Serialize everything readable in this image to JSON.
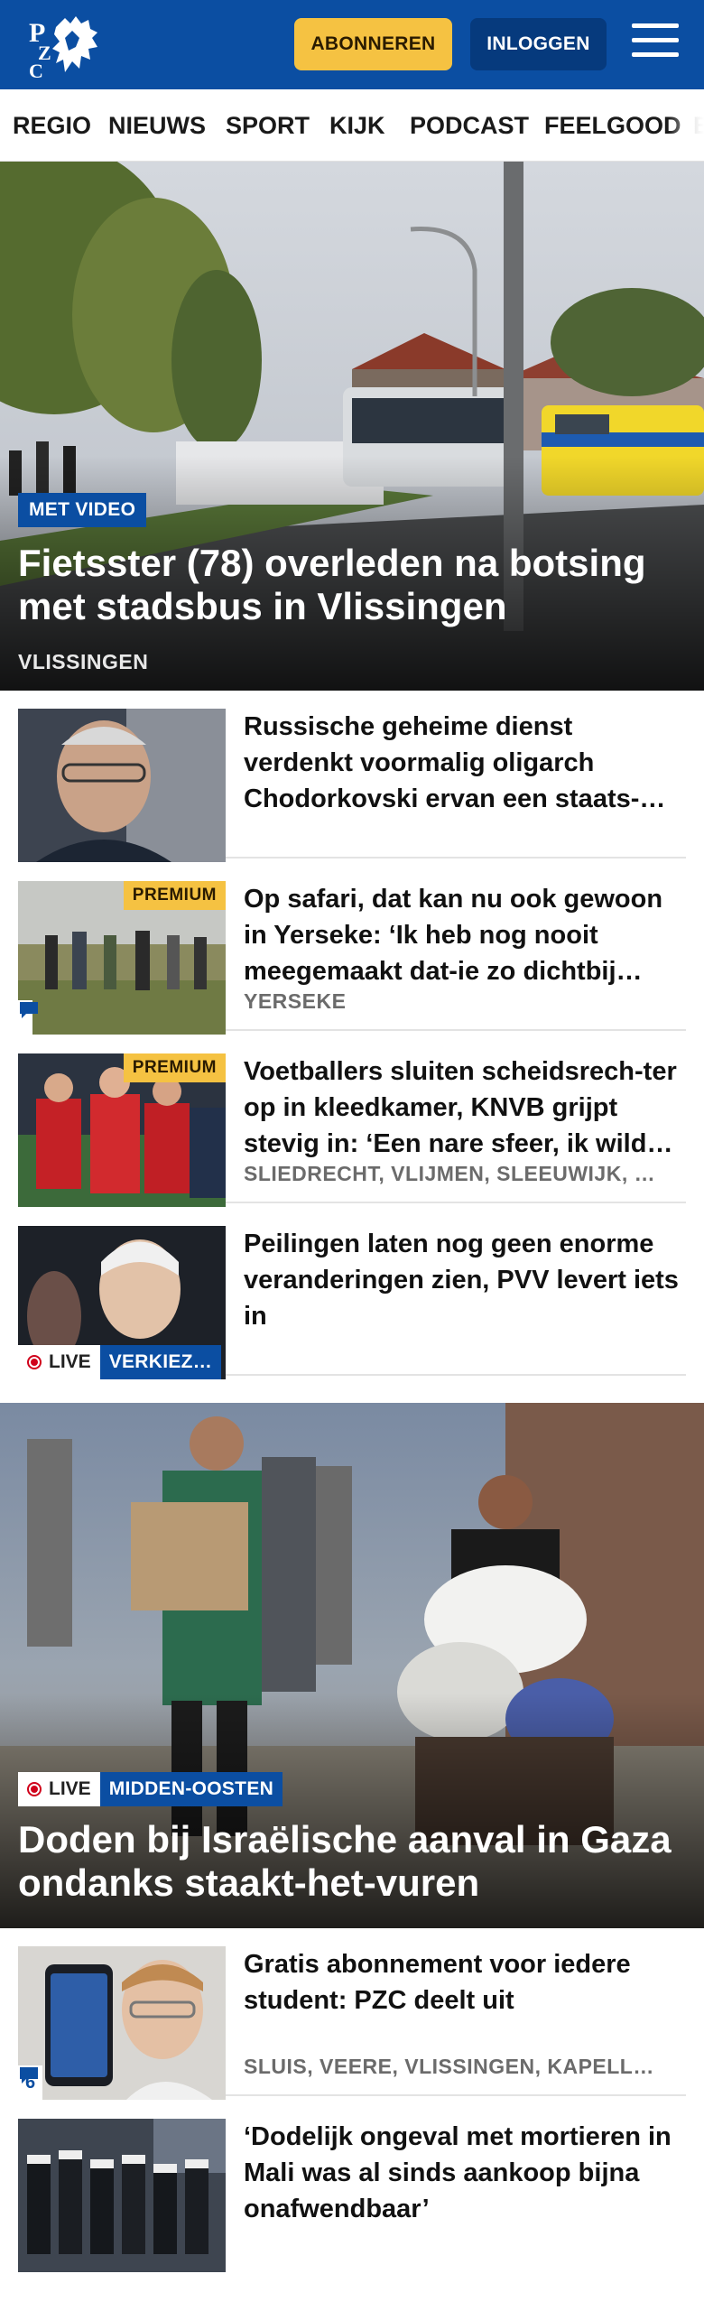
{
  "header": {
    "logo_text": "PZC",
    "subscribe_label": "ABONNEREN",
    "login_label": "INLOGGEN",
    "brand_color": "#0b4ea2",
    "accent_color": "#f5c242"
  },
  "nav": {
    "items": [
      "REGIO",
      "NIEUWS",
      "SPORT",
      "KIJK",
      "PODCAST",
      "FEELGOOD",
      "B"
    ]
  },
  "hero": {
    "badge": "MET VIDEO",
    "title": "Fietsster (78) overleden na botsing met stadsbus in Vlissingen",
    "location": "VLISSINGEN"
  },
  "articles": [
    {
      "title": "Russische geheime dienst verdenkt voormalig oligarch Chodorkovski ervan een staats-…",
      "location": "",
      "premium": ""
    },
    {
      "title": "Op safari, dat kan nu ook gewoon in Yerseke: ‘Ik heb nog nooit meegemaakt dat-ie zo dichtbij…",
      "location": "YERSEKE",
      "premium": "PREMIUM",
      "comments_icon": "comment-icon"
    },
    {
      "title": "Voetballers sluiten scheidsrech-ter op in kleedkamer, KNVB grijpt stevig in: ‘Een nare sfeer, ik wild…",
      "location": "SLIEDRECHT, VLIJMEN, SLEEUWIJK, …",
      "premium": "PREMIUM"
    },
    {
      "title": "Peilingen laten nog geen enorme veranderingen zien, PVV levert iets in",
      "location": "",
      "live_label": "LIVE",
      "live_topic": "VERKIEZ…"
    }
  ],
  "hero2": {
    "live_label": "LIVE",
    "topic": "MIDDEN-OOSTEN",
    "title": "Doden bij Israëlische aanval in Gaza ondanks staakt-het-vuren"
  },
  "articles2": [
    {
      "title": "Gratis abonnement voor iedere student: PZC deelt uit",
      "location": "SLUIS, VEERE, VLISSINGEN, KAPELL…",
      "comments_count": "6"
    },
    {
      "title": "‘Dodelijk ongeval met mortieren in Mali was al sinds aankoop bijna onafwendbaar’",
      "location": ""
    }
  ]
}
